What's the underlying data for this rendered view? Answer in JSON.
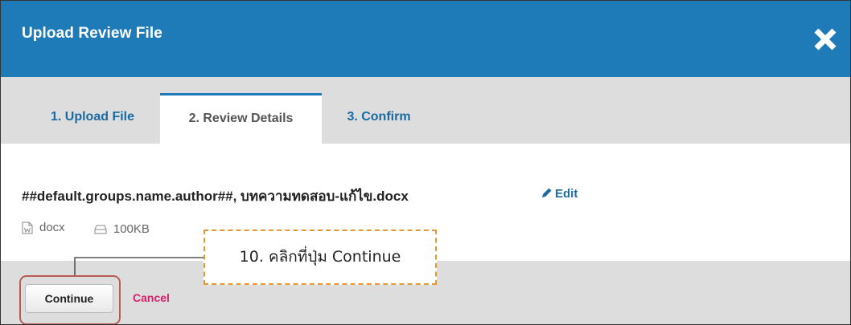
{
  "dialog": {
    "title": "Upload Review File",
    "close_icon": "close-icon"
  },
  "tabs": [
    {
      "label": "1. Upload File",
      "active": false
    },
    {
      "label": "2. Review Details",
      "active": true
    },
    {
      "label": "3. Confirm",
      "active": false
    }
  ],
  "file": {
    "title": "##default.groups.name.author##, บทความทดสอบ-แก้ไข.docx",
    "edit_label": "Edit",
    "type": "docx",
    "size": "100KB"
  },
  "footer": {
    "continue_label": "Continue",
    "cancel_label": "Cancel"
  },
  "annotation": {
    "text": "10. คลิกที่ปุ่ม Continue"
  },
  "colors": {
    "header": "#1e7bb8",
    "tab_link": "#1a6aa3",
    "cancel": "#d6206b",
    "callout_border": "#e8962e",
    "highlight": "#b75c52"
  }
}
